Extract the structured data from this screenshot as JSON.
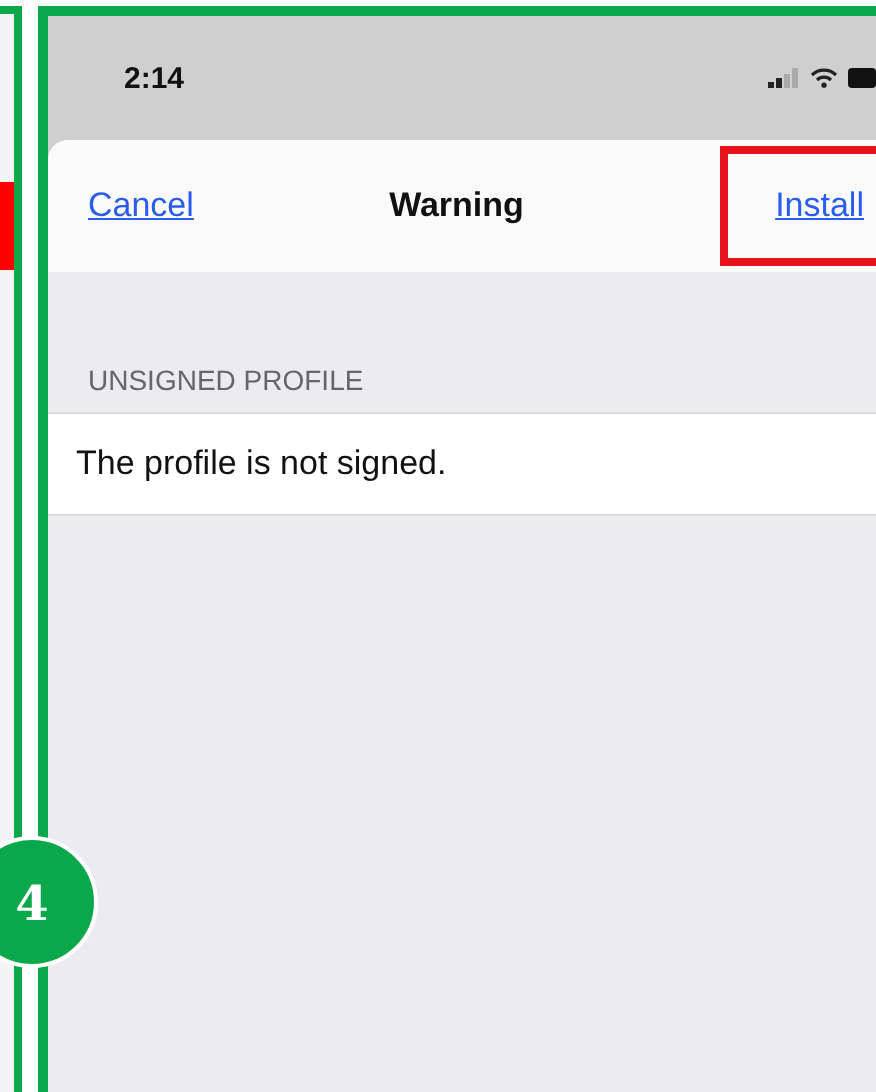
{
  "status_bar": {
    "time": "2:14"
  },
  "nav_bar": {
    "cancel": "Cancel",
    "title": "Warning",
    "action": {
      "label": "Install",
      "highlighted": true
    }
  },
  "section": {
    "header": "UNSIGNED PROFILE",
    "rows": [
      "The profile is not signed."
    ]
  },
  "step_badge": "4"
}
